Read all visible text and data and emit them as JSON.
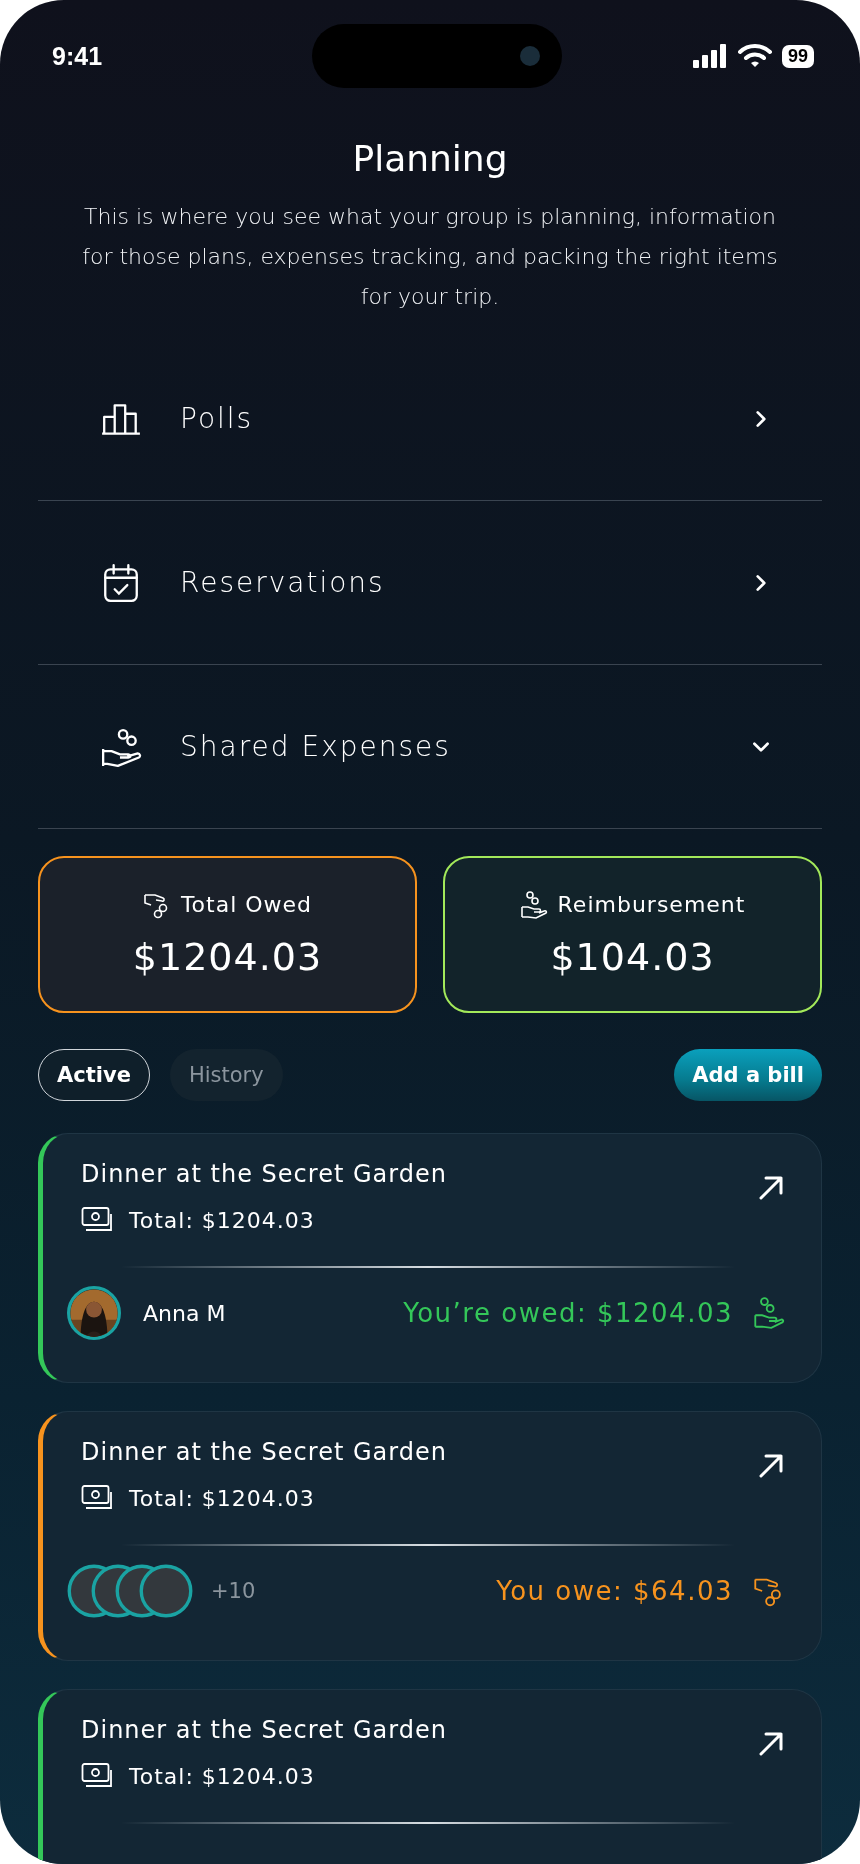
{
  "status_bar": {
    "time": "9:41",
    "battery": "99"
  },
  "header": {
    "title": "Planning",
    "description": "This is where you see what your group is planning, information for those plans, expenses tracking, and packing the right items for your trip."
  },
  "menu": [
    {
      "label": "Polls",
      "expanded": false
    },
    {
      "label": "Reservations",
      "expanded": false
    },
    {
      "label": "Shared Expenses",
      "expanded": true
    }
  ],
  "summary": [
    {
      "kind": "owed",
      "label": "Total Owed",
      "amount": "$1204.03"
    },
    {
      "kind": "reimbursement",
      "label": "Reimbursement",
      "amount": "$104.03"
    }
  ],
  "tabs": [
    {
      "label": "Active",
      "selected": true
    },
    {
      "label": "History",
      "selected": false
    }
  ],
  "add_button": "Add a bill",
  "bills": [
    {
      "kind": "owed",
      "title": "Dinner at the Secret Garden",
      "total": "Total: $1204.03",
      "person": "Anna M",
      "amount": "You’re owed: $1204.03"
    },
    {
      "kind": "owe",
      "title": "Dinner at the Secret Garden",
      "total": "Total: $1204.03",
      "participants": [
        {
          "kind": "placeholder"
        },
        {
          "kind": "placeholder"
        },
        {
          "kind": "placeholder"
        },
        {
          "kind": "placeholder"
        }
      ],
      "extra": "+10",
      "amount": "You owe: $64.03"
    },
    {
      "kind": "owed",
      "title": "Dinner at the Secret Garden",
      "total": "Total: $1204.03"
    }
  ]
}
